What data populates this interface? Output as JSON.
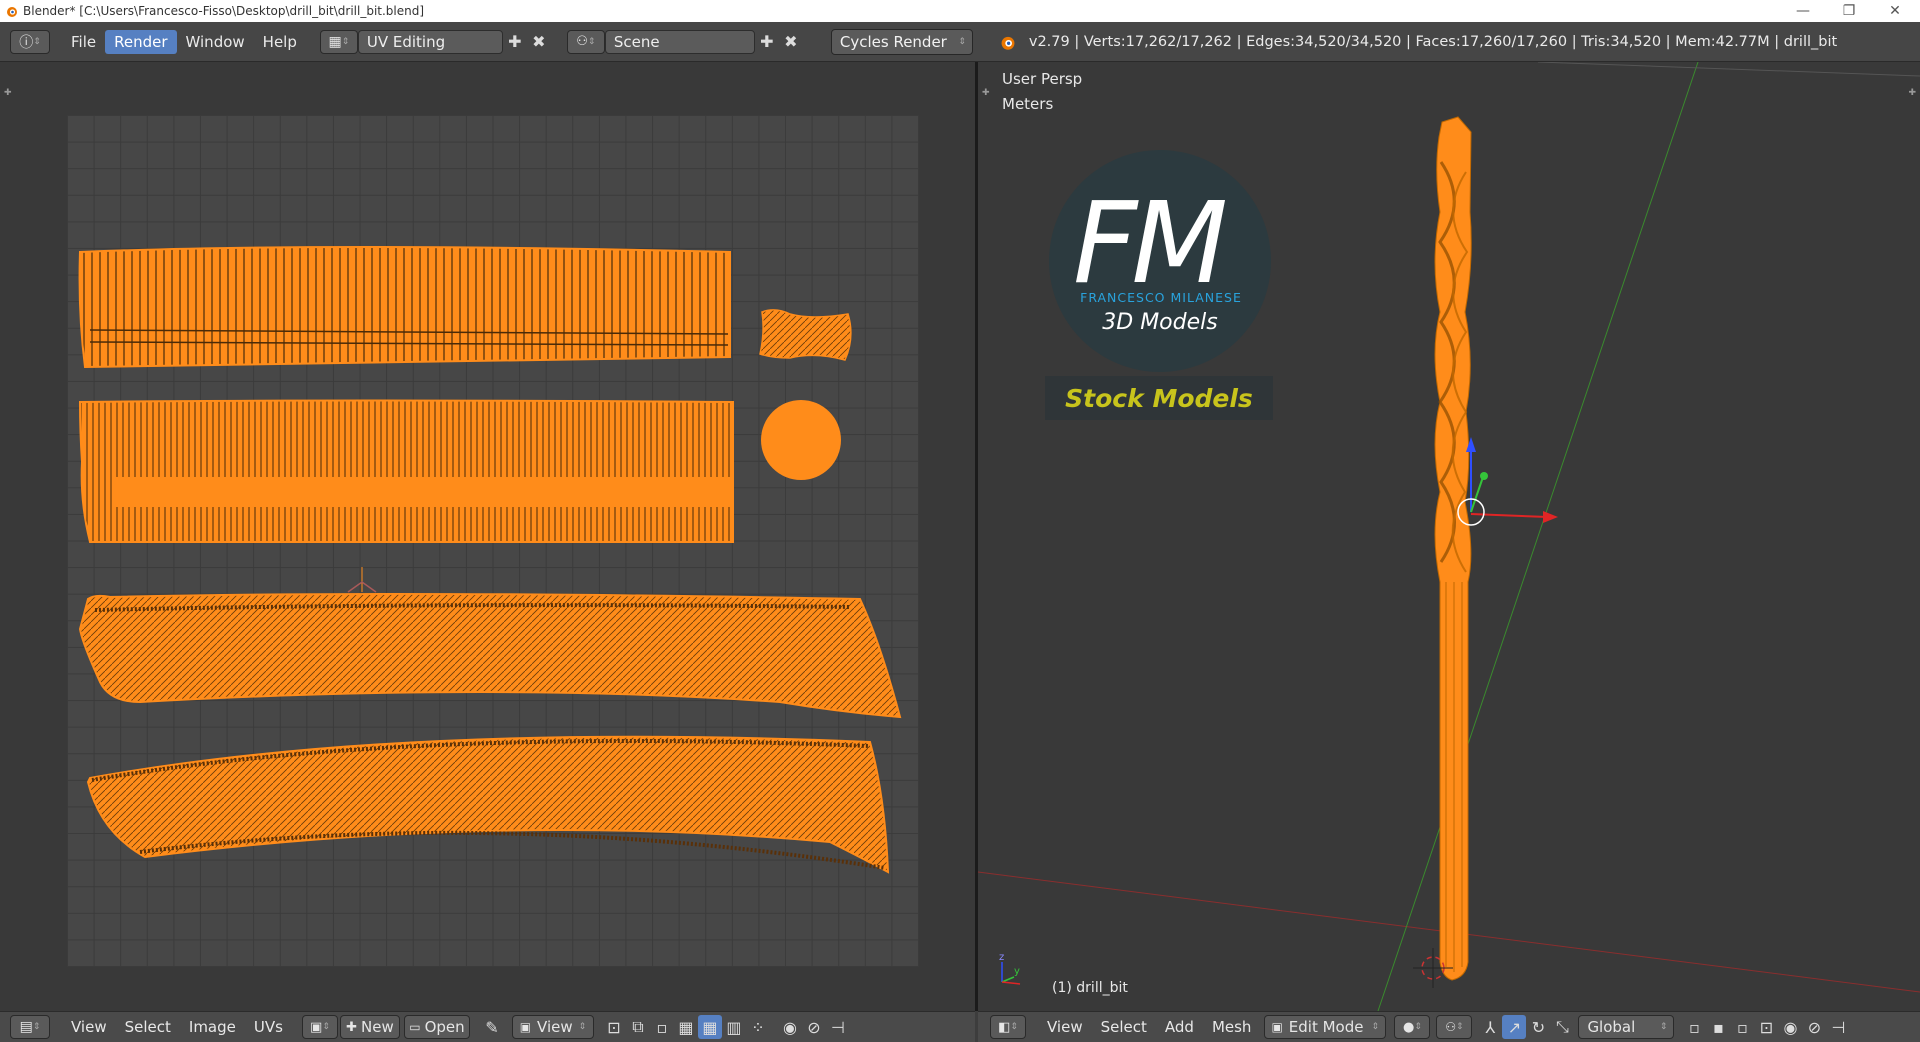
{
  "window": {
    "title": "Blender* [C:\\Users\\Francesco-Fisso\\Desktop\\drill_bit\\drill_bit.blend]",
    "minimize": "—",
    "restore": "❐",
    "close": "✕"
  },
  "topbar": {
    "menu": [
      "File",
      "Render",
      "Window",
      "Help"
    ],
    "active_menu": "Render",
    "screen_layout": "UV Editing",
    "scene": "Scene",
    "render_engine": "Cycles Render",
    "stats": "v2.79 | Verts:17,262/17,262 | Edges:34,520/34,520 | Faces:17,260/17,260 | Tris:34,520 | Mem:42.77M | drill_bit"
  },
  "viewport": {
    "view_name": "User Persp",
    "units": "Meters",
    "object_label": "(1) drill_bit"
  },
  "logo": {
    "monogram": "FM",
    "brand": "FRANCESCO MILANESE",
    "subtitle": "3D Models",
    "tagline": "Stock Models"
  },
  "uv_bottombar": {
    "items": [
      "View",
      "Select",
      "Image",
      "UVs"
    ],
    "new_label": "New",
    "open_label": "Open",
    "view_label": "View"
  },
  "viewport_bottombar": {
    "items": [
      "View",
      "Select",
      "Add",
      "Mesh"
    ],
    "mode": "Edit Mode",
    "orientation": "Global"
  },
  "colors": {
    "accent": "#5680c2",
    "mesh": "#ff8c1a",
    "logo_blue": "#29a3dd",
    "logo_yellow": "#c8c41c"
  }
}
